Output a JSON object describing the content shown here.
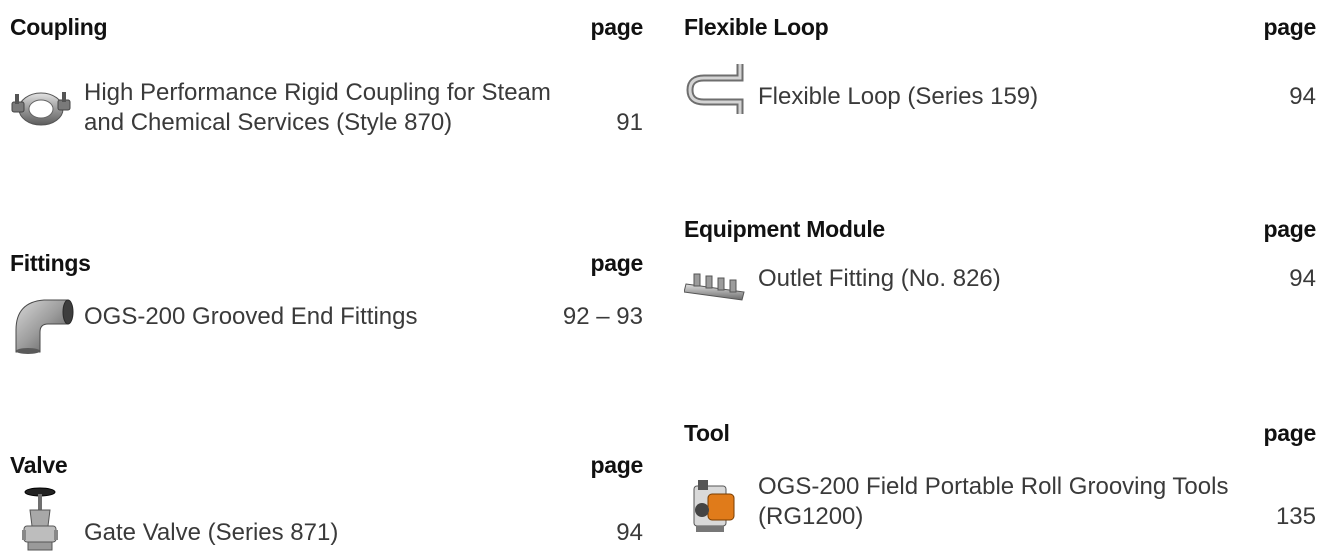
{
  "sections": {
    "coupling": {
      "title": "Coupling",
      "page_label": "page",
      "entry": {
        "text": "High Performance Rigid Coupling for Steam\nand Chemical Services (Style 870)",
        "page": "91",
        "icon": "rigid-coupling-icon"
      }
    },
    "fittings": {
      "title": "Fittings",
      "page_label": "page",
      "entry": {
        "text": "OGS-200 Grooved End Fittings",
        "page": "92 – 93",
        "icon": "elbow-fitting-icon"
      }
    },
    "valve": {
      "title": "Valve",
      "page_label": "page",
      "entry": {
        "text": "Gate Valve (Series 871)",
        "page": "94",
        "icon": "gate-valve-icon"
      }
    },
    "flexible_loop": {
      "title": "Flexible Loop",
      "page_label": "page",
      "entry": {
        "text": "Flexible Loop (Series 159)",
        "page": "94",
        "icon": "flexible-loop-icon"
      }
    },
    "equipment_module": {
      "title": "Equipment Module",
      "page_label": "page",
      "entry": {
        "text": "Outlet Fitting (No. 826)",
        "page": "94",
        "icon": "outlet-fitting-icon"
      }
    },
    "tool": {
      "title": "Tool",
      "page_label": "page",
      "entry": {
        "text": "OGS-200 Field Portable Roll Grooving Tools\n(RG1200)",
        "page": "135",
        "icon": "roll-grooving-tool-icon"
      }
    }
  }
}
